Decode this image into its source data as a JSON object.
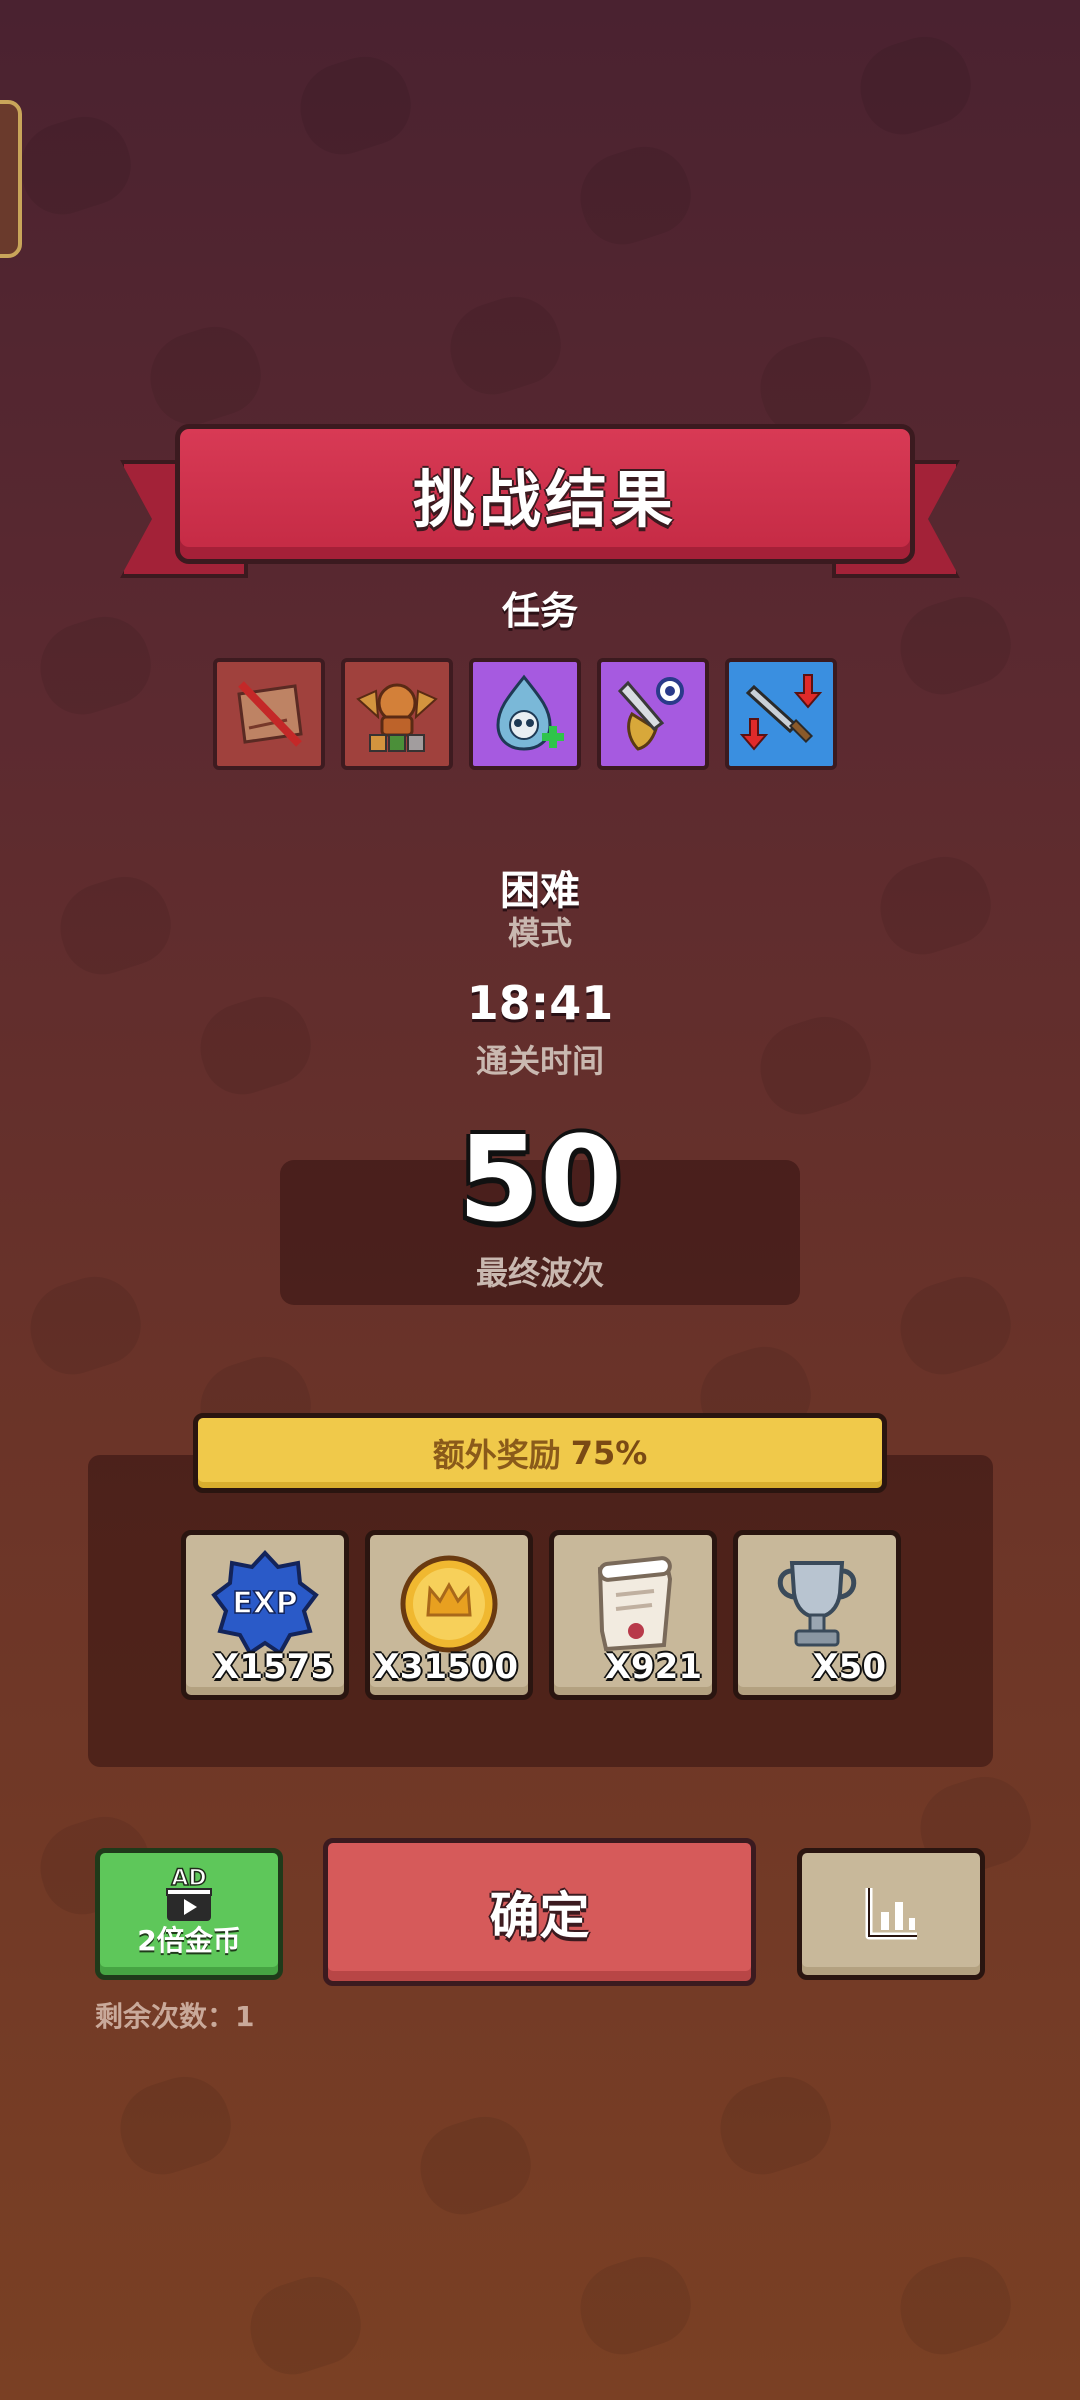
{
  "title": "挑战结果",
  "tasks": {
    "label": "任务",
    "items": [
      {
        "icon": "crossed-map-icon",
        "state": "failed"
      },
      {
        "icon": "winged-helmet-icon",
        "state": "failed"
      },
      {
        "icon": "skull-drop-plus-icon",
        "state": "epic"
      },
      {
        "icon": "dagger-shield-icon",
        "state": "epic"
      },
      {
        "icon": "sword-down-arrows-icon",
        "state": "rare"
      }
    ]
  },
  "mode": {
    "value": "困难",
    "label": "模式"
  },
  "clear_time": {
    "value": "18:41",
    "label": "通关时间"
  },
  "final_wave": {
    "value": "50",
    "label": "最终波次"
  },
  "bonus": {
    "label": "额外奖励",
    "value": "75%"
  },
  "rewards": [
    {
      "icon": "exp-badge-icon",
      "qty": "X1575"
    },
    {
      "icon": "gold-coin-icon",
      "qty": "X31500"
    },
    {
      "icon": "scroll-icon",
      "qty": "X921"
    },
    {
      "icon": "trophy-icon",
      "qty": "X50"
    }
  ],
  "buttons": {
    "ad_badge": "AD",
    "ad_label": "2倍金币",
    "remaining": "剩余次数：1",
    "confirm": "确定",
    "stats_icon": "bar-chart-icon"
  },
  "colors": {
    "banner": "#c42a44",
    "bonus_bar": "#f0c94a",
    "ad_button": "#5ec75a",
    "confirm_button": "#d65a5a",
    "reward_tile": "#c8b89a"
  }
}
